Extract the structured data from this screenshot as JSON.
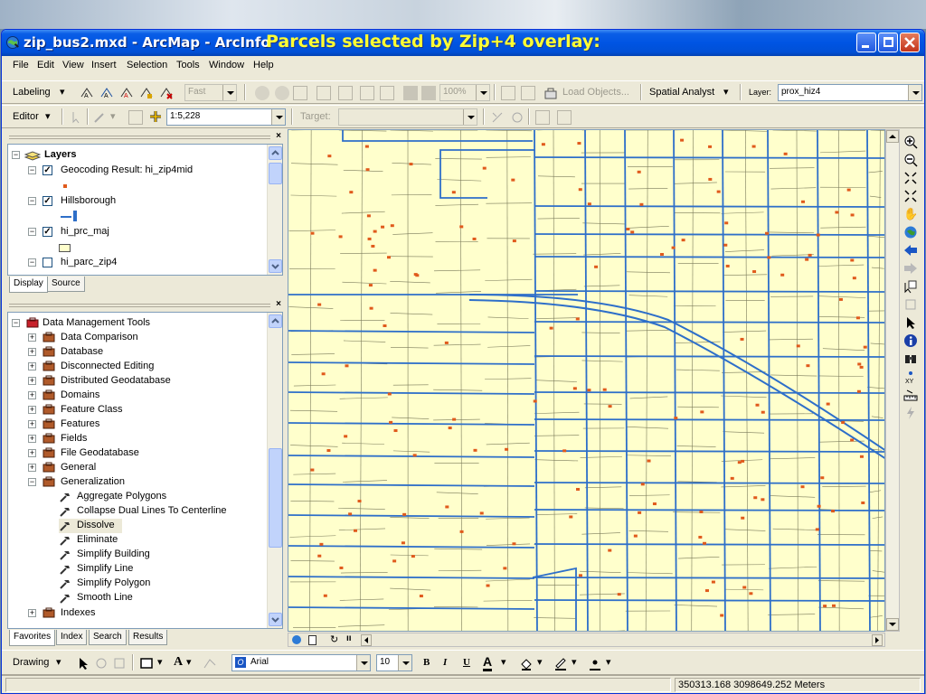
{
  "window": {
    "title": "zip_bus2.mxd - ArcMap - ArcInfo",
    "overlay_caption": "Parcels selected by Zip+4 overlay:"
  },
  "menu": [
    "File",
    "Edit",
    "View",
    "Insert",
    "Selection",
    "Tools",
    "Window",
    "Help"
  ],
  "labeling_toolbar": {
    "labeling_label": "Labeling",
    "speed_value": "Fast",
    "zoom_value": "100%",
    "load_objects_label": "Load Objects...",
    "spatial_analyst_label": "Spatial Analyst",
    "layer_label": "Layer:",
    "layer_value": "prox_hiz4"
  },
  "editor_toolbar": {
    "editor_label": "Editor",
    "scale_value": "1:5,228",
    "target_label": "Target:",
    "target_value": ""
  },
  "toc": {
    "root_label": "Layers",
    "layers": [
      {
        "name": "Geocoding Result: hi_zip4mid",
        "checked": true,
        "expanded": true
      },
      {
        "name": "Hillsborough",
        "checked": true,
        "expanded": true
      },
      {
        "name": "hi_prc_maj",
        "checked": true,
        "expanded": true
      },
      {
        "name": "hi_parc_zip4",
        "checked": false,
        "expanded": true
      }
    ],
    "tabs": [
      "Display",
      "Source"
    ]
  },
  "toolbox": {
    "root_label": "Data Management Tools",
    "toolsets": [
      "Data Comparison",
      "Database",
      "Disconnected Editing",
      "Distributed Geodatabase",
      "Domains",
      "Feature Class",
      "Features",
      "Fields",
      "File Geodatabase",
      "General",
      "Generalization"
    ],
    "generalization_tools": [
      "Aggregate Polygons",
      "Collapse Dual Lines To Centerline",
      "Dissolve",
      "Eliminate",
      "Simplify Building",
      "Simplify Line",
      "Simplify Polygon",
      "Smooth Line"
    ],
    "selected_tool": "Dissolve",
    "after_label": "Indexes",
    "tabs": [
      "Favorites",
      "Index",
      "Search",
      "Results"
    ]
  },
  "drawing_toolbar": {
    "drawing_label": "Drawing",
    "font_value": "Arial",
    "size_value": "10",
    "bold": "B",
    "italic": "I",
    "underline": "U",
    "font_color_letter": "A"
  },
  "status": {
    "coordinates": "350313.168  3098649.252 Meters"
  },
  "colors": {
    "parcel_fill": "#ffffcc",
    "parcel_edge": "#7a7a5a",
    "street_line": "#2e6fc9",
    "selected_point": "#e05a1c",
    "title_bar": "#0054e3",
    "overlay_caption": "#ffff33"
  },
  "right_tools": [
    "zoom-in-icon",
    "zoom-out-icon",
    "fixed-zoom-in-icon",
    "fixed-zoom-out-icon",
    "pan-icon",
    "full-extent-icon",
    "back-extent-icon",
    "forward-extent-icon",
    "select-features-icon",
    "select-elements-icon",
    "select-pointer-icon",
    "identify-icon",
    "find-icon",
    "go-to-xy-icon",
    "measure-icon",
    "hyperlink-icon"
  ]
}
